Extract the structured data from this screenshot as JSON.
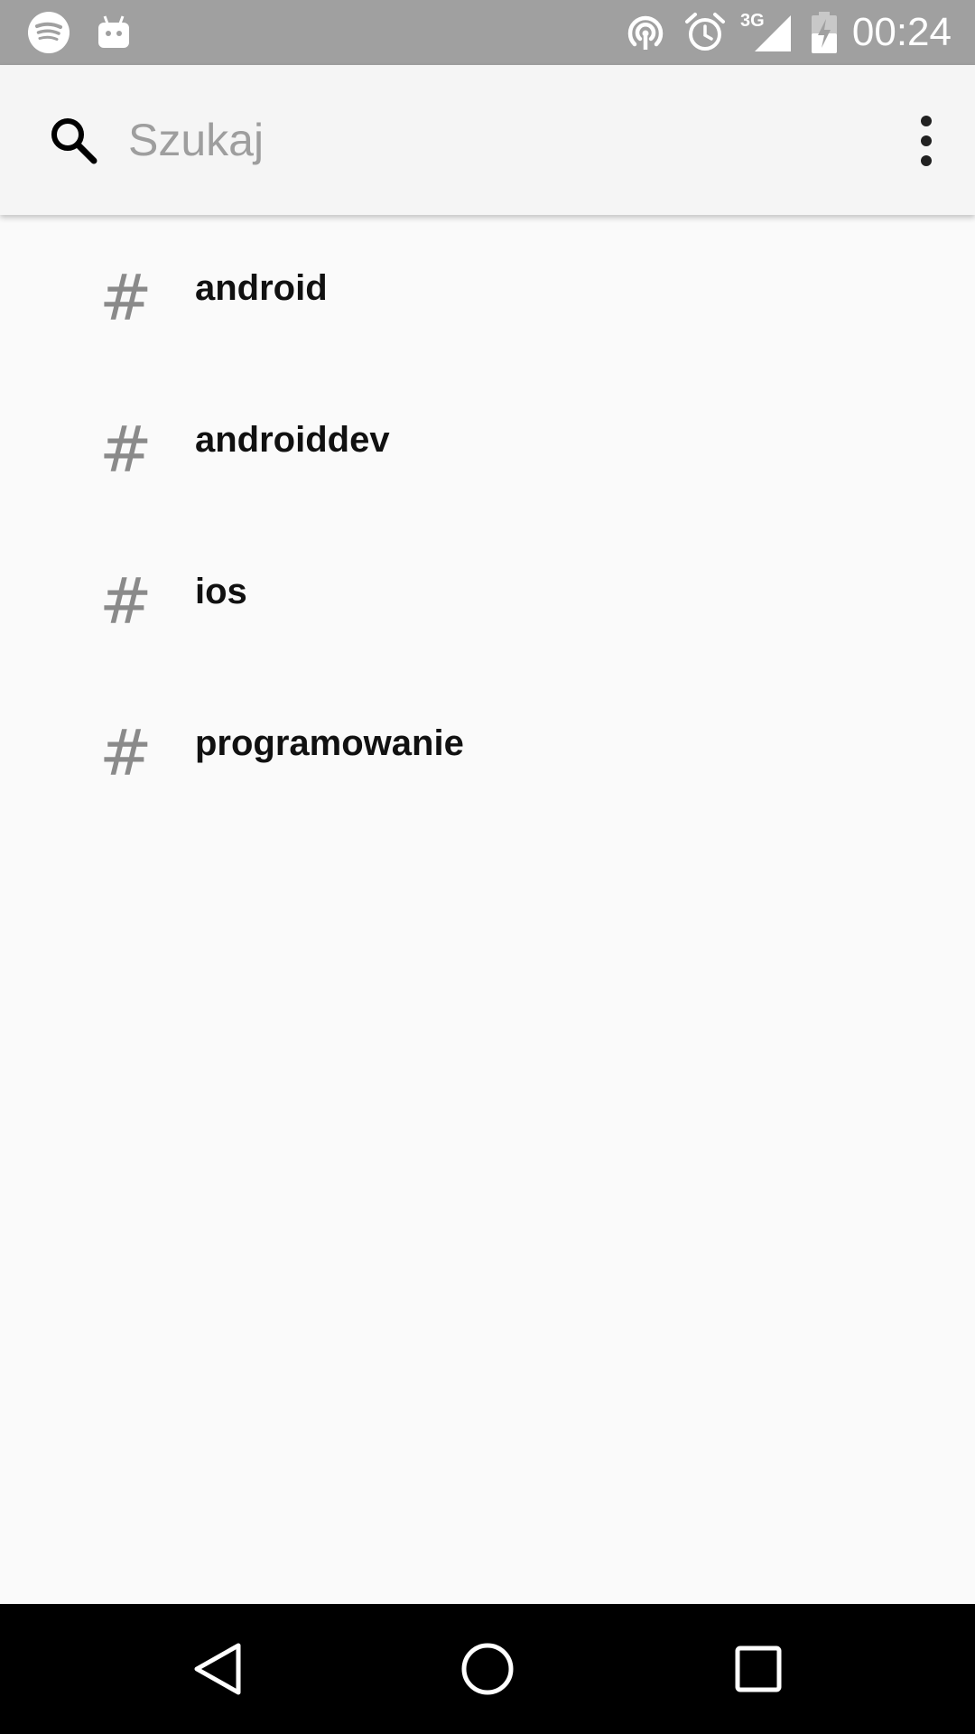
{
  "status_bar": {
    "time": "00:24",
    "network_label": "3G",
    "left_icons": [
      "spotify-icon",
      "android-robot-icon"
    ],
    "right_icons": [
      "hotspot-icon",
      "alarm-icon",
      "signal-3g-icon",
      "battery-charging-icon"
    ]
  },
  "search": {
    "placeholder": "Szukaj",
    "value": "",
    "icon": "search-icon",
    "menu_icon": "more-vert-icon"
  },
  "tags": [
    {
      "symbol": "#",
      "label": "android"
    },
    {
      "symbol": "#",
      "label": "androiddev"
    },
    {
      "symbol": "#",
      "label": "ios"
    },
    {
      "symbol": "#",
      "label": "programowanie"
    }
  ],
  "nav_bar": {
    "buttons": [
      "back-icon",
      "home-icon",
      "recents-icon"
    ]
  },
  "colors": {
    "status_bar": "#a0a0a0",
    "search_bar": "#f5f5f5",
    "background": "#fafafa",
    "hash": "#8a8a8a",
    "nav_bar": "#000000"
  }
}
